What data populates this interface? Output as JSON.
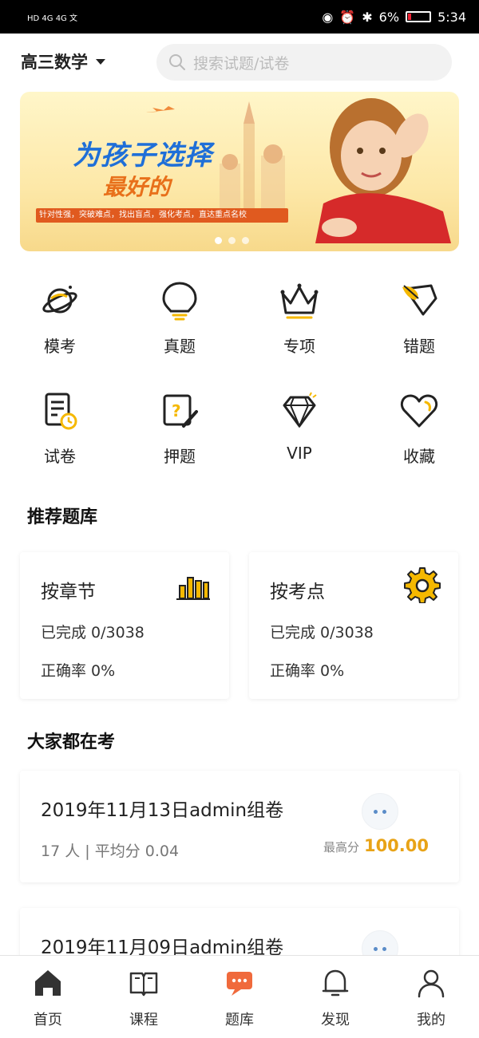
{
  "status_bar": {
    "left_text": "HD 4G 4G 文",
    "battery": "6%",
    "time": "5:34"
  },
  "header": {
    "subject": "高三数学",
    "search_placeholder": "搜索试题/试卷"
  },
  "banner": {
    "headline": "为孩子选择",
    "subheadline": "最好的",
    "tagline": "针对性强，突破难点，找出盲点，强化考点，直达重点名校"
  },
  "categories": [
    {
      "label": "模考",
      "icon": "planet-icon"
    },
    {
      "label": "真题",
      "icon": "bulb-icon"
    },
    {
      "label": "专项",
      "icon": "crown-icon"
    },
    {
      "label": "错题",
      "icon": "wrong-note-icon"
    },
    {
      "label": "试卷",
      "icon": "paper-clock-icon"
    },
    {
      "label": "押题",
      "icon": "question-pen-icon"
    },
    {
      "label": "VIP",
      "icon": "diamond-icon"
    },
    {
      "label": "收藏",
      "icon": "heart-icon"
    }
  ],
  "recommend": {
    "title": "推荐题库",
    "cards": [
      {
        "title": "按章节",
        "progress": "已完成 0/3038",
        "accuracy": "正确率 0%",
        "icon": "bar-chart-icon"
      },
      {
        "title": "按考点",
        "progress": "已完成 0/3038",
        "accuracy": "正确率 0%",
        "icon": "gear-icon"
      }
    ]
  },
  "popular": {
    "title": "大家都在考",
    "exams": [
      {
        "title": "2019年11月13日admin组卷",
        "meta": "17 人 | 平均分 0.04",
        "best_label": "最高分",
        "best_score": "100.00"
      },
      {
        "title": "2019年11月09日admin组卷",
        "meta": "",
        "best_label": "",
        "best_score": ""
      }
    ]
  },
  "tabbar": [
    {
      "label": "首页",
      "icon": "home-icon"
    },
    {
      "label": "课程",
      "icon": "book-icon"
    },
    {
      "label": "题库",
      "icon": "chat-icon"
    },
    {
      "label": "发现",
      "icon": "bell-icon"
    },
    {
      "label": "我的",
      "icon": "user-icon"
    }
  ],
  "colors": {
    "accent": "#f5b800",
    "active_tab": "#f06a3c",
    "score": "#e8a317"
  }
}
